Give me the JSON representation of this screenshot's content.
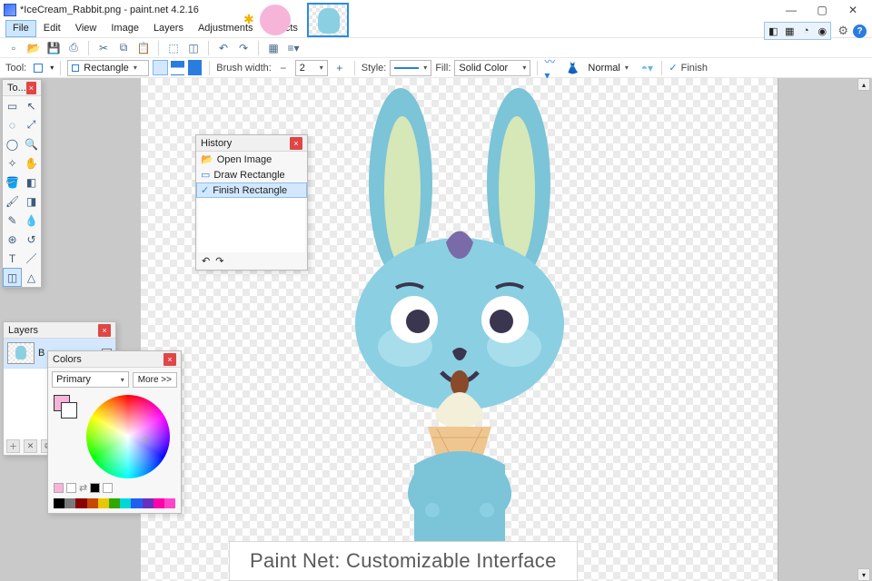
{
  "title": "*IceCream_Rabbit.png - paint.net 4.2.16",
  "window_buttons": {
    "min": "—",
    "max": "▢",
    "close": "✕"
  },
  "menu": [
    "File",
    "Edit",
    "View",
    "Image",
    "Layers",
    "Adjustments",
    "Effects"
  ],
  "topright_icons": [
    "◧",
    "▦",
    "◔",
    "◉"
  ],
  "toolbar2": {
    "tool_label": "Tool:",
    "shape": "Rectangle",
    "brushwidth_label": "Brush width:",
    "brushwidth_value": "2",
    "style_label": "Style:",
    "fill_label": "Fill:",
    "fill_value": "Solid Color",
    "blend": "Normal",
    "finish": "Finish"
  },
  "tools_panel": {
    "title": "To..."
  },
  "history_panel": {
    "title": "History",
    "items": [
      "Open Image",
      "Draw Rectangle",
      "Finish Rectangle"
    ]
  },
  "layers_panel": {
    "title": "Layers",
    "layer_name": "B"
  },
  "colors_panel": {
    "title": "Colors",
    "mode": "Primary",
    "more": "More >>",
    "strip": [
      "#000",
      "#7a7a7a",
      "#8a0000",
      "#c84800",
      "#e8c800",
      "#30a800",
      "#2060f0",
      "#6830c0",
      "#f7b4d9",
      "#ff44cc"
    ]
  },
  "caption": "Paint Net: Customizable Interface"
}
